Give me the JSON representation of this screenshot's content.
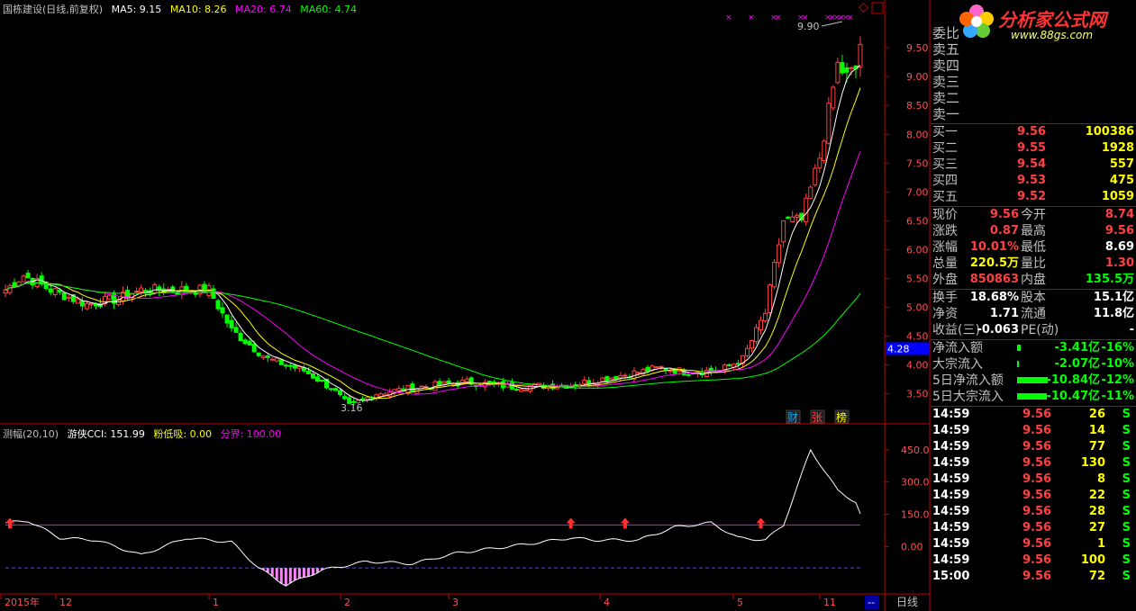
{
  "header": {
    "title": "国栋建设(日线,前复权)",
    "ma": [
      {
        "label": "MA5: 9.15",
        "color": "#ffffff"
      },
      {
        "label": "MA10: 8.26",
        "color": "#ffff00"
      },
      {
        "label": "MA20: 6.74",
        "color": "#ff00ff"
      },
      {
        "label": "MA60: 4.74",
        "color": "#00ff00"
      }
    ]
  },
  "price_axis": {
    "ticks": [
      "9.50",
      "9.00",
      "8.50",
      "8.00",
      "7.50",
      "7.00",
      "6.50",
      "6.00",
      "5.50",
      "5.00",
      "4.50",
      "4.00",
      "3.50"
    ],
    "current_marker": "4.28"
  },
  "price_labels": {
    "high": "9.90",
    "low": "3.16"
  },
  "badges": [
    {
      "label": "财",
      "color": "#00aaff"
    },
    {
      "label": "张",
      "color": "#ff4040"
    },
    {
      "label": "榜",
      "color": "#ffff00"
    }
  ],
  "indicator": {
    "name": "测幅(20,10)",
    "cci": "游侠CCI: 151.99",
    "absorb": "粉低吸: 0.00",
    "boundary": "分界: 100.00",
    "ticks": [
      "450.0",
      "300.0",
      "150.0",
      "0.00"
    ]
  },
  "time_axis": {
    "labels": [
      "2015年",
      "12",
      "1",
      "2",
      "3",
      "4",
      "5",
      "11"
    ],
    "period_button": "日线"
  },
  "chart_data": {
    "type": "candlestick",
    "title": "国栋建设(日线,前复权)",
    "high": 9.9,
    "low": 3.16,
    "last": 9.56,
    "ma_values": {
      "MA5": 9.15,
      "MA10": 8.26,
      "MA20": 6.74,
      "MA60": 4.74
    },
    "ylim": [
      3.1,
      10.05
    ],
    "indicator_last": 151.99,
    "indicator_boundary": 100.0,
    "indicator_ylim": [
      -200,
      500
    ]
  },
  "logo": {
    "text": "分析家公式网",
    "url": "www.88gs.com"
  },
  "quote": {
    "sell": [
      {
        "label": "卖五",
        "price": "",
        "vol": ""
      },
      {
        "label": "卖四",
        "price": "",
        "vol": ""
      },
      {
        "label": "卖三",
        "price": "",
        "vol": ""
      },
      {
        "label": "卖二",
        "price": "",
        "vol": ""
      },
      {
        "label": "卖一",
        "price": "",
        "vol": ""
      }
    ],
    "sell_header": "委比",
    "buy": [
      {
        "label": "买一",
        "price": "9.56",
        "vol": "100386"
      },
      {
        "label": "买二",
        "price": "9.55",
        "vol": "1928"
      },
      {
        "label": "买三",
        "price": "9.54",
        "vol": "557"
      },
      {
        "label": "买四",
        "price": "9.53",
        "vol": "475"
      },
      {
        "label": "买五",
        "price": "9.52",
        "vol": "1059"
      }
    ],
    "stats": [
      {
        "l1": "现价",
        "v1": "9.56",
        "c1": "#ff4040",
        "l2": "今开",
        "v2": "8.74",
        "c2": "#ff4040"
      },
      {
        "l1": "涨跌",
        "v1": "0.87",
        "c1": "#ff4040",
        "l2": "最高",
        "v2": "9.56",
        "c2": "#ff4040"
      },
      {
        "l1": "涨幅",
        "v1": "10.01%",
        "c1": "#ff4040",
        "l2": "最低",
        "v2": "8.69",
        "c2": "#ffffff"
      },
      {
        "l1": "总量",
        "v1": "220.5万",
        "c1": "#ffff00",
        "l2": "量比",
        "v2": "1.30",
        "c2": "#ff4040"
      },
      {
        "l1": "外盘",
        "v1": "850863",
        "c1": "#ff4040",
        "l2": "内盘",
        "v2": "135.5万",
        "c2": "#00ff00"
      }
    ],
    "stats2": [
      {
        "l1": "换手",
        "v1": "18.68%",
        "c1": "#ffffff",
        "l2": "股本",
        "v2": "15.1亿",
        "c2": "#ffffff"
      },
      {
        "l1": "净资",
        "v1": "1.71",
        "c1": "#ffffff",
        "l2": "流通",
        "v2": "11.8亿",
        "c2": "#ffffff"
      },
      {
        "l1": "收益(三)",
        "v1": "-0.063",
        "c1": "#ffffff",
        "l2": "PE(动)",
        "v2": "-",
        "c2": "#ffffff"
      }
    ],
    "flows": [
      {
        "label": "净流入额",
        "value": "-3.41亿",
        "pct": "-16%",
        "bar": 0.12
      },
      {
        "label": "大宗流入",
        "value": "-2.07亿",
        "pct": "-10%",
        "bar": 0.06
      },
      {
        "label": "5日净流入额",
        "value": "-10.84亿",
        "pct": "-12%",
        "bar": 1.0
      },
      {
        "label": "5日大宗流入",
        "value": "-10.47亿",
        "pct": "-11%",
        "bar": 0.97
      }
    ],
    "ticks": [
      {
        "time": "14:59",
        "price": "9.56",
        "vol": "26",
        "side": "S"
      },
      {
        "time": "14:59",
        "price": "9.56",
        "vol": "14",
        "side": "S"
      },
      {
        "time": "14:59",
        "price": "9.56",
        "vol": "77",
        "side": "S"
      },
      {
        "time": "14:59",
        "price": "9.56",
        "vol": "130",
        "side": "S"
      },
      {
        "time": "14:59",
        "price": "9.56",
        "vol": "8",
        "side": "S"
      },
      {
        "time": "14:59",
        "price": "9.56",
        "vol": "22",
        "side": "S"
      },
      {
        "time": "14:59",
        "price": "9.56",
        "vol": "28",
        "side": "S"
      },
      {
        "time": "14:59",
        "price": "9.56",
        "vol": "27",
        "side": "S"
      },
      {
        "time": "14:59",
        "price": "9.56",
        "vol": "1",
        "side": "S"
      },
      {
        "time": "14:59",
        "price": "9.56",
        "vol": "100",
        "side": "S"
      },
      {
        "time": "15:00",
        "price": "9.56",
        "vol": "72",
        "side": "S"
      }
    ]
  },
  "colors": {
    "up": "#ff4040",
    "down": "#00ff00",
    "frame": "#c00000",
    "boundary": "#ff00ff",
    "panel_text": "#c0c0c0"
  }
}
